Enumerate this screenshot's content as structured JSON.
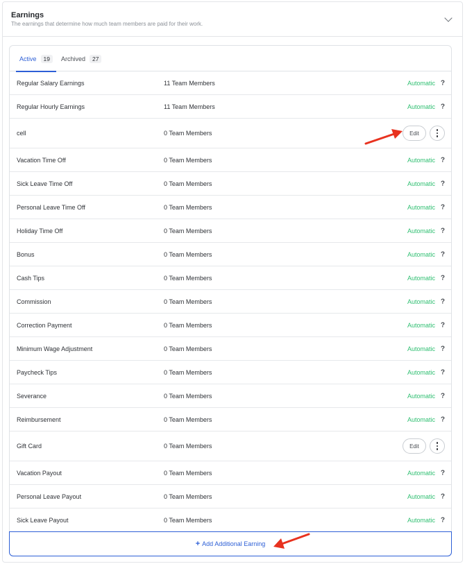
{
  "section": {
    "title": "Earnings",
    "subtitle": "The earnings that determine how much team members are paid for their work."
  },
  "tabs": [
    {
      "label": "Active",
      "count": "19"
    },
    {
      "label": "Archived",
      "count": "27"
    }
  ],
  "rows": [
    {
      "name": "Regular Salary Earnings",
      "members": "11 Team Members",
      "status": "Automatic",
      "help": "?"
    },
    {
      "name": "Regular Hourly Earnings",
      "members": "11 Team Members",
      "status": "Automatic",
      "help": "?"
    },
    {
      "name": "cell",
      "members": "0 Team Members",
      "edit": "Edit"
    },
    {
      "name": "Vacation Time Off",
      "members": "0 Team Members",
      "status": "Automatic",
      "help": "?"
    },
    {
      "name": "Sick Leave Time Off",
      "members": "0 Team Members",
      "status": "Automatic",
      "help": "?"
    },
    {
      "name": "Personal Leave Time Off",
      "members": "0 Team Members",
      "status": "Automatic",
      "help": "?"
    },
    {
      "name": "Holiday Time Off",
      "members": "0 Team Members",
      "status": "Automatic",
      "help": "?"
    },
    {
      "name": "Bonus",
      "members": "0 Team Members",
      "status": "Automatic",
      "help": "?"
    },
    {
      "name": "Cash Tips",
      "members": "0 Team Members",
      "status": "Automatic",
      "help": "?"
    },
    {
      "name": "Commission",
      "members": "0 Team Members",
      "status": "Automatic",
      "help": "?"
    },
    {
      "name": "Correction Payment",
      "members": "0 Team Members",
      "status": "Automatic",
      "help": "?"
    },
    {
      "name": "Minimum Wage Adjustment",
      "members": "0 Team Members",
      "status": "Automatic",
      "help": "?"
    },
    {
      "name": "Paycheck Tips",
      "members": "0 Team Members",
      "status": "Automatic",
      "help": "?"
    },
    {
      "name": "Severance",
      "members": "0 Team Members",
      "status": "Automatic",
      "help": "?"
    },
    {
      "name": "Reimbursement",
      "members": "0 Team Members",
      "status": "Automatic",
      "help": "?"
    },
    {
      "name": "Gift Card",
      "members": "0 Team Members",
      "edit": "Edit"
    },
    {
      "name": "Vacation Payout",
      "members": "0 Team Members",
      "status": "Automatic",
      "help": "?"
    },
    {
      "name": "Personal Leave Payout",
      "members": "0 Team Members",
      "status": "Automatic",
      "help": "?"
    },
    {
      "name": "Sick Leave Payout",
      "members": "0 Team Members",
      "status": "Automatic",
      "help": "?"
    }
  ],
  "add_button": {
    "icon": "+",
    "label": "Add Additional Earning"
  },
  "colors": {
    "accent": "#2d5fd6",
    "automatic": "#2fbf71",
    "arrow": "#e8321f"
  }
}
